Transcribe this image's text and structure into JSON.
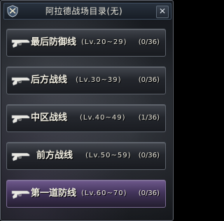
{
  "window": {
    "title": "阿拉德战场目录(无)",
    "close_label": "✕",
    "accent_color": "#2a3340"
  },
  "zones": [
    {
      "name": "最后防御线",
      "level": "(Lv.20~29)",
      "count": "(0/36)",
      "icon": "gun-icon",
      "highlight": false
    },
    {
      "name": "后方战线",
      "level": "(Lv.30~39)",
      "count": "(0/36)",
      "icon": "gun-icon",
      "highlight": false
    },
    {
      "name": "中区战线",
      "level": "(Lv.40~49)",
      "count": "(1/36)",
      "icon": "gun-icon",
      "highlight": false
    },
    {
      "name": "前方战线",
      "level": "(Lv.50~59)",
      "count": "(0/36)",
      "icon": "gun-icon",
      "highlight": false
    },
    {
      "name": "第一道防线",
      "level": "(Lv.60~70)",
      "count": "(0/36)",
      "icon": "gun-icon",
      "highlight": true
    }
  ]
}
